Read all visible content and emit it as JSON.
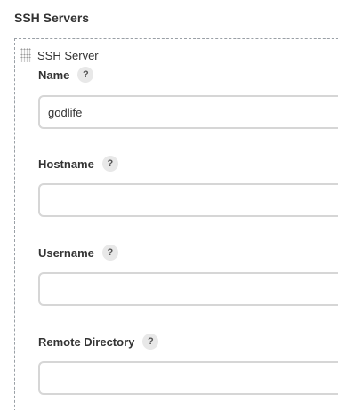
{
  "section": {
    "title": "SSH Servers"
  },
  "server": {
    "label": "SSH Server",
    "fields": {
      "name": {
        "label": "Name",
        "help": "?",
        "value": "godlife"
      },
      "hostname": {
        "label": "Hostname",
        "help": "?",
        "value": ""
      },
      "username": {
        "label": "Username",
        "help": "?",
        "value": ""
      },
      "remote_directory": {
        "label": "Remote Directory",
        "help": "?",
        "value": ""
      }
    }
  }
}
